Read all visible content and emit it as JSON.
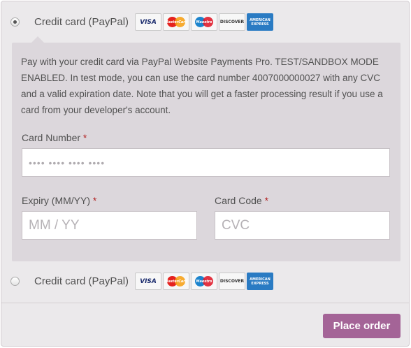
{
  "payment_methods": [
    {
      "label": "Credit card (PayPal)",
      "selected": true,
      "card_logos": [
        {
          "name": "visa-logo",
          "text": "VISA"
        },
        {
          "name": "mastercard-logo",
          "text": "MasterCard"
        },
        {
          "name": "maestro-logo",
          "text": "Maestro"
        },
        {
          "name": "discover-logo",
          "text": "DISCOVER"
        },
        {
          "name": "amex-logo",
          "text": "AMERICAN EXPRESS"
        }
      ]
    },
    {
      "label": "Credit card (PayPal)",
      "selected": false,
      "card_logos": [
        {
          "name": "visa-logo",
          "text": "VISA"
        },
        {
          "name": "mastercard-logo",
          "text": "MasterCard"
        },
        {
          "name": "maestro-logo",
          "text": "Maestro"
        },
        {
          "name": "discover-logo",
          "text": "DISCOVER"
        },
        {
          "name": "amex-logo",
          "text": "AMERICAN EXPRESS"
        }
      ]
    }
  ],
  "payment_box": {
    "description": "Pay with your credit card via PayPal Website Payments Pro. TEST/SANDBOX MODE ENABLED. In test mode, you can use the card number 4007000000027 with any CVC and a valid expiration date. Note that you will get a faster processing result if you use a card from your developer's account.",
    "card_number": {
      "label": "Card Number",
      "required_mark": "*",
      "placeholder": "•••• •••• •••• ••••",
      "value": ""
    },
    "expiry": {
      "label": "Expiry (MM/YY)",
      "required_mark": "*",
      "placeholder": "MM / YY",
      "value": ""
    },
    "card_code": {
      "label": "Card Code",
      "required_mark": "*",
      "placeholder": "CVC",
      "value": ""
    }
  },
  "place_order_label": "Place order",
  "colors": {
    "panel_bg": "#ebe9eb",
    "box_bg": "#dcd7dc",
    "button_bg": "#a46497",
    "required": "#b22222"
  }
}
